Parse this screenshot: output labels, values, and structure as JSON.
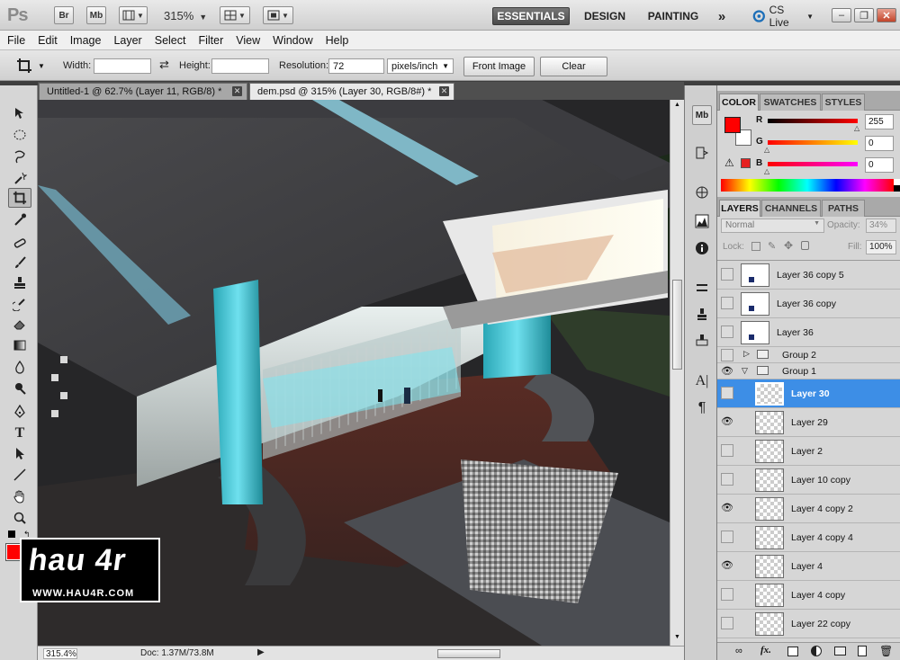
{
  "app": {
    "logo": "Ps",
    "btn_br": "Br",
    "btn_mb": "Mb",
    "zoom": "315%",
    "workspaces": [
      "ESSENTIALS",
      "DESIGN",
      "PAINTING"
    ],
    "more": "»",
    "cslive": "CS Live",
    "min": "–",
    "restore": "❐",
    "close": "✕"
  },
  "menu": [
    "File",
    "Edit",
    "Image",
    "Layer",
    "Select",
    "Filter",
    "View",
    "Window",
    "Help"
  ],
  "options": {
    "width_label": "Width:",
    "width_value": "",
    "swap": "⇄",
    "height_label": "Height:",
    "height_value": "",
    "resolution_label": "Resolution:",
    "resolution_value": "72",
    "unit": "pixels/inch",
    "front_image": "Front Image",
    "clear": "Clear"
  },
  "tabs": [
    {
      "label": "Untitled-1 @ 62.7% (Layer 11, RGB/8) *",
      "close": "✕"
    },
    {
      "label": "dem.psd @ 315% (Layer 30, RGB/8#) *",
      "close": "✕"
    }
  ],
  "status": {
    "zoom": "315.4%",
    "doc": "Doc: 1.37M/73.8M",
    "arrow": "▶"
  },
  "watermark": {
    "text": "hau 4r",
    "url": "WWW.HAU4R.COM"
  },
  "color_panel": {
    "tabs": [
      "COLOR",
      "SWATCHES",
      "STYLES"
    ],
    "labels": {
      "r": "R",
      "g": "G",
      "b": "B"
    },
    "values": {
      "r": "255",
      "g": "0",
      "b": "0"
    },
    "fg_color": "#ff0000",
    "bg_color": "#ffffff"
  },
  "layers_panel": {
    "tabs": [
      "LAYERS",
      "CHANNELS",
      "PATHS"
    ],
    "blend_mode": "Normal",
    "opacity_label": "Opacity:",
    "opacity_value": "34%",
    "lock_label": "Lock:",
    "fill_label": "Fill:",
    "fill_value": "100%",
    "layers": [
      {
        "name": "Layer 36 copy 5",
        "visible": false
      },
      {
        "name": "Layer 36 copy",
        "visible": false
      },
      {
        "name": "Layer 36",
        "visible": false
      },
      {
        "name": "Group 2",
        "group": true,
        "expanded": false,
        "visible": false
      },
      {
        "name": "Group 1",
        "group": true,
        "expanded": true,
        "visible": true
      },
      {
        "name": "Layer 30",
        "visible": false,
        "selected": true
      },
      {
        "name": "Layer 29",
        "visible": true
      },
      {
        "name": "Layer 2",
        "visible": false
      },
      {
        "name": "Layer 10 copy",
        "visible": false
      },
      {
        "name": "Layer 4 copy 2",
        "visible": true
      },
      {
        "name": "Layer 4 copy 4",
        "visible": false
      },
      {
        "name": "Layer 4",
        "visible": true
      },
      {
        "name": "Layer 4 copy",
        "visible": false
      },
      {
        "name": "Layer 22 copy",
        "visible": false
      }
    ]
  }
}
